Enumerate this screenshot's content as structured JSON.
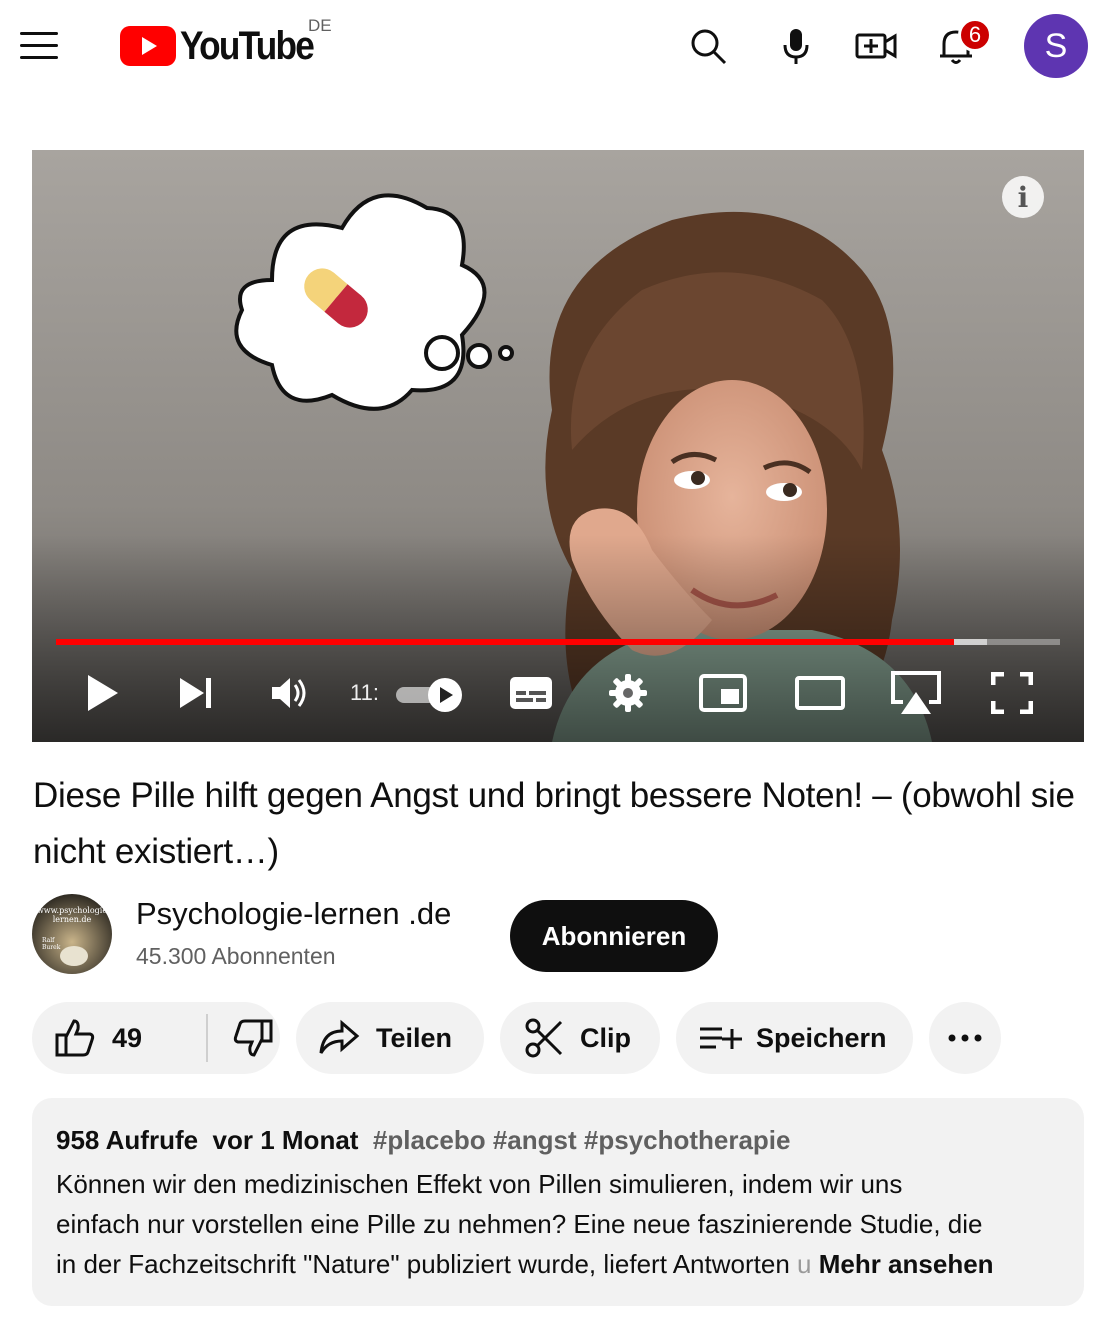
{
  "header": {
    "logo_text": "YouTube",
    "region": "DE",
    "notification_count": "6",
    "avatar_letter": "S",
    "colors": {
      "brand_red": "#ff0000",
      "avatar_bg": "#5e35b1",
      "badge": "#cc0000"
    },
    "icons": [
      "menu-icon",
      "search-icon",
      "microphone-icon",
      "create-video-icon",
      "bell-icon"
    ]
  },
  "player": {
    "time_display": "11:",
    "progress_played_fraction": 0.894,
    "progress_buffered_fraction": 0.927,
    "controls": [
      "play-icon",
      "next-icon",
      "volume-icon",
      "autoplay-toggle",
      "subtitles-icon",
      "settings-icon",
      "miniplayer-icon",
      "theater-mode-icon",
      "airplay-icon",
      "fullscreen-icon"
    ]
  },
  "video": {
    "title": "Diese Pille hilft gegen Angst und bringt bessere Noten! – (obwohl sie nicht existiert…)"
  },
  "channel": {
    "name": "Psychologie-lernen .de",
    "subscribers": "45.300 Abonnenten",
    "avatar_text_1": "www.psychologie",
    "avatar_text_2": "lernen.de",
    "avatar_text_3": "Ralf",
    "avatar_text_4": "Burek",
    "subscribe_label": "Abonnieren"
  },
  "actions": {
    "like_count": "49",
    "share_label": "Teilen",
    "clip_label": "Clip",
    "save_label": "Speichern"
  },
  "description": {
    "views": "958 Aufrufe",
    "age": "vor 1 Monat",
    "hashtags": "#placebo #angst #psychotherapie",
    "line1": "Können wir den medizinischen Effekt von Pillen simulieren, indem wir uns",
    "line2": "einfach nur vorstellen eine Pille zu nehmen? Eine neue faszinierende Studie, die",
    "line3": "in der Fachzeitschrift \"Nature\" publiziert wurde, liefert Antworten",
    "line3_fade": "u",
    "more_label": "Mehr ansehen"
  }
}
